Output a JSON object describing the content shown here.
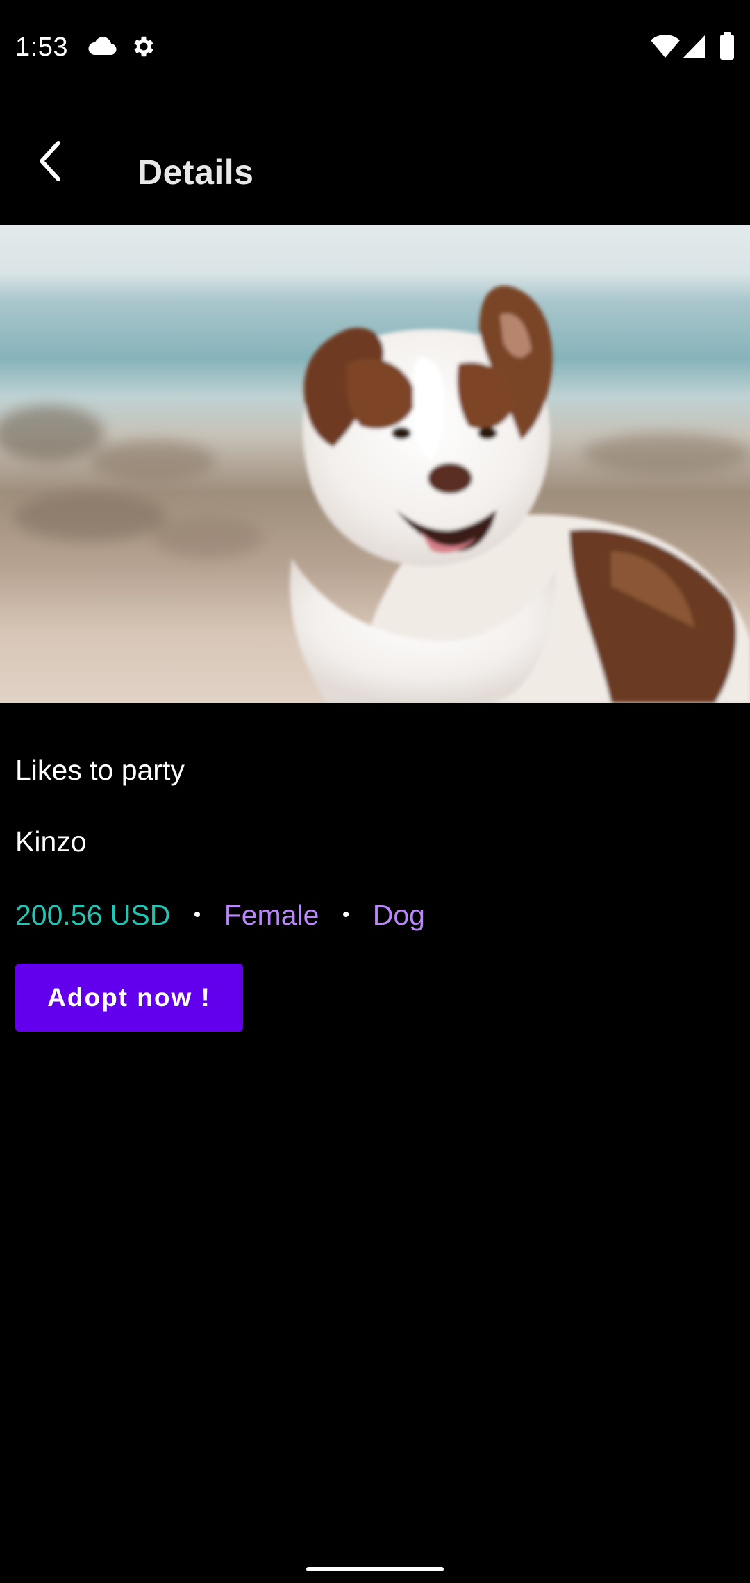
{
  "status_bar": {
    "time": "1:53",
    "left_icons": [
      "cloud-icon",
      "gear-icon"
    ],
    "right_icons": [
      "wifi-icon",
      "cell-signal-icon",
      "battery-icon"
    ]
  },
  "app_bar": {
    "back_icon": "chevron-left-icon",
    "title": "Details"
  },
  "hero_image": {
    "subject": "dog"
  },
  "pet": {
    "tagline": "Likes to party",
    "name": "Kinzo",
    "price": "200.56 USD",
    "separator": "•",
    "gender": "Female",
    "species": "Dog"
  },
  "actions": {
    "adopt_label": "Adopt now !"
  },
  "colors": {
    "background": "#000000",
    "price": "#1fc7b6",
    "attribute": "#bb86fc",
    "primary_button": "#6200ee"
  }
}
